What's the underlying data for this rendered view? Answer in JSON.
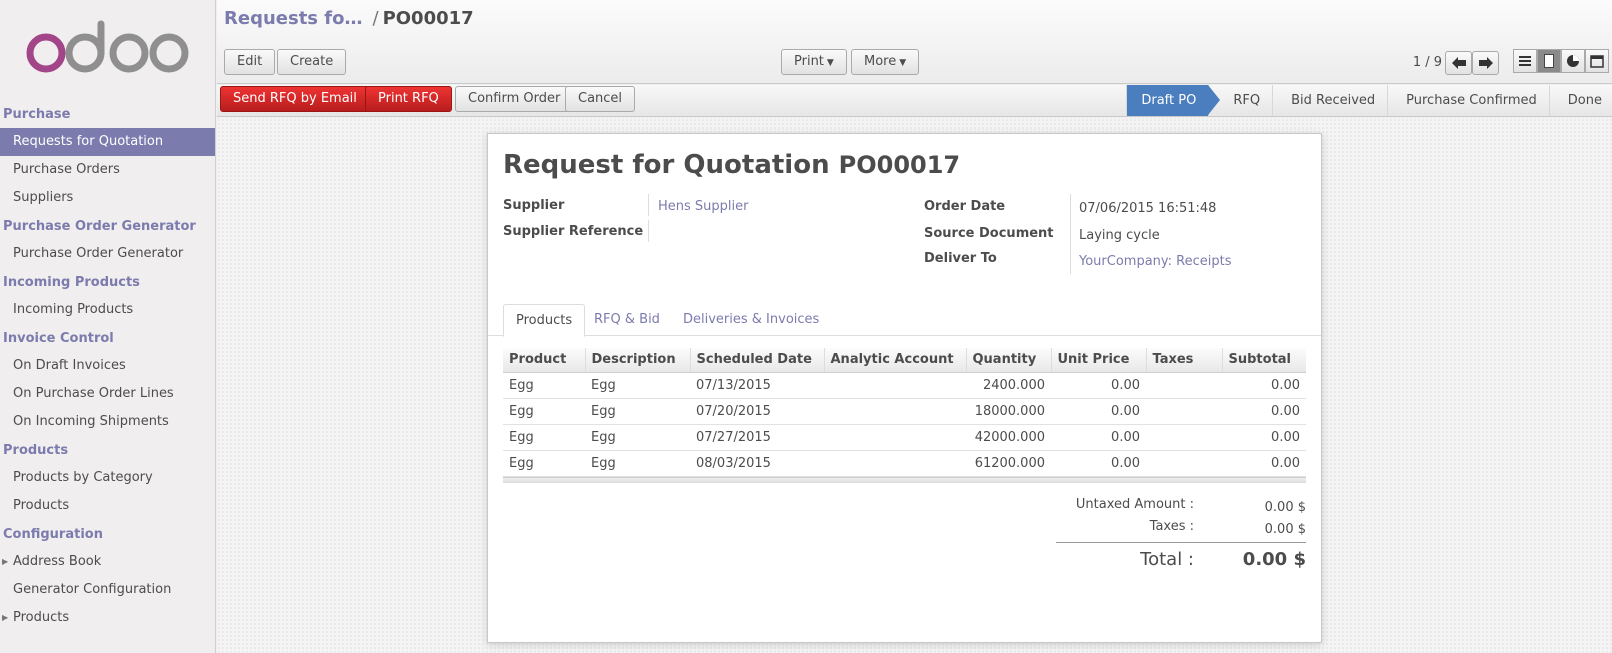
{
  "sidebar": {
    "logo_text": "odoo",
    "sections": [
      {
        "title": "Purchase",
        "items": [
          {
            "label": "Requests for Quotation",
            "active": true
          },
          {
            "label": "Purchase Orders"
          },
          {
            "label": "Suppliers"
          }
        ]
      },
      {
        "title": "Purchase Order Generator",
        "items": [
          {
            "label": "Purchase Order Generator"
          }
        ]
      },
      {
        "title": "Incoming Products",
        "items": [
          {
            "label": "Incoming Products"
          }
        ]
      },
      {
        "title": "Invoice Control",
        "items": [
          {
            "label": "On Draft Invoices"
          },
          {
            "label": "On Purchase Order Lines"
          },
          {
            "label": "On Incoming Shipments"
          }
        ]
      },
      {
        "title": "Products",
        "items": [
          {
            "label": "Products by Category"
          },
          {
            "label": "Products"
          }
        ]
      },
      {
        "title": "Configuration",
        "items": [
          {
            "label": "Address Book",
            "caret": true
          },
          {
            "label": "Generator Configuration"
          },
          {
            "label": "Products",
            "caret": true
          }
        ]
      }
    ]
  },
  "breadcrumb": {
    "parent": "Requests fo…",
    "sep": "/",
    "current": "PO00017"
  },
  "toolbar": {
    "edit": "Edit",
    "create": "Create",
    "print": "Print",
    "more": "More",
    "pager": "1 / 9"
  },
  "statusbar": {
    "send_rfq": "Send RFQ by Email",
    "print_rfq": "Print RFQ",
    "confirm": "Confirm Order",
    "cancel": "Cancel",
    "stages": [
      "Draft PO",
      "RFQ",
      "Bid Received",
      "Purchase Confirmed",
      "Done"
    ],
    "current_stage": "Draft PO"
  },
  "form": {
    "title": "Request for Quotation",
    "number": "PO00017",
    "supplier_label": "Supplier",
    "supplier_value": "Hens Supplier",
    "supplier_ref_label": "Supplier Reference",
    "order_date_label": "Order Date",
    "order_date_value": "07/06/2015 16:51:48",
    "source_doc_label": "Source Document",
    "source_doc_value": "Laying cycle",
    "deliver_to_label": "Deliver To",
    "deliver_to_value": "YourCompany: Receipts"
  },
  "tabs": [
    "Products",
    "RFQ & Bid",
    "Deliveries & Invoices"
  ],
  "lines": {
    "headers": [
      "Product",
      "Description",
      "Scheduled Date",
      "Analytic Account",
      "Quantity",
      "Unit Price",
      "Taxes",
      "Subtotal"
    ],
    "rows": [
      [
        "Egg",
        "Egg",
        "07/13/2015",
        "",
        "2400.000",
        "0.00",
        "",
        "0.00"
      ],
      [
        "Egg",
        "Egg",
        "07/20/2015",
        "",
        "18000.000",
        "0.00",
        "",
        "0.00"
      ],
      [
        "Egg",
        "Egg",
        "07/27/2015",
        "",
        "42000.000",
        "0.00",
        "",
        "0.00"
      ],
      [
        "Egg",
        "Egg",
        "08/03/2015",
        "",
        "61200.000",
        "0.00",
        "",
        "0.00"
      ]
    ]
  },
  "totals": {
    "untaxed_label": "Untaxed Amount :",
    "untaxed_value": "0.00 $",
    "taxes_label": "Taxes :",
    "taxes_value": "0.00 $",
    "total_label": "Total :",
    "total_value": "0.00 $"
  },
  "colors": {
    "accent": "#7c7bad",
    "primary_button": "#d32a2a",
    "current_stage": "#4a7ebf"
  }
}
